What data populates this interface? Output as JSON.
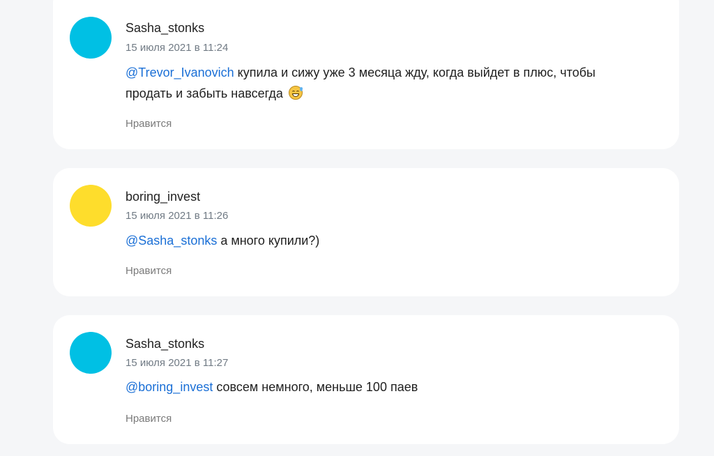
{
  "comments": [
    {
      "author": "Sasha_stonks",
      "timestamp": "15 июля 2021 в 11:24",
      "mention": "@Trevor_Ivanovich",
      "text_line1": " купила и сижу уже 3 месяца жду, когда выйдет в плюс, чтобы",
      "text_line2": "продать и забыть навсегда ",
      "emoji": "grinning-face-with-sweat-icon",
      "like_label": "Нравится",
      "avatar_color": "#00c0e4"
    },
    {
      "author": "boring_invest",
      "timestamp": "15 июля 2021 в 11:26",
      "mention": "@Sasha_stonks",
      "text": " а много купили?)",
      "like_label": "Нравится",
      "avatar_color": "#fedd2c"
    },
    {
      "author": "Sasha_stonks",
      "timestamp": "15 июля 2021 в 11:27",
      "mention": "@boring_invest",
      "text": " совсем немного, меньше 100 паев",
      "like_label": "Нравится",
      "avatar_color": "#00c0e4"
    }
  ],
  "colors": {
    "background": "#f5f6f8",
    "card": "#ffffff",
    "mention": "#1a6fd6",
    "meta": "#707a84"
  }
}
